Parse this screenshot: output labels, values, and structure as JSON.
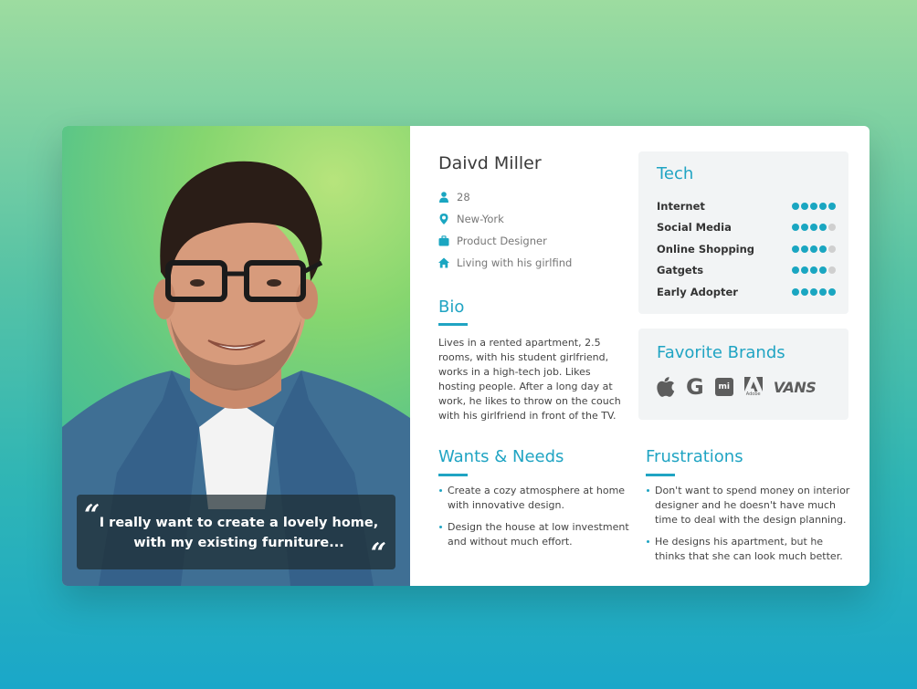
{
  "persona": {
    "name": "Daivd Miller",
    "facts": [
      {
        "icon": "person-icon",
        "text": "28"
      },
      {
        "icon": "location-pin-icon",
        "text": "New-York"
      },
      {
        "icon": "briefcase-icon",
        "text": "Product Designer"
      },
      {
        "icon": "home-icon",
        "text": "Living with his girlfind"
      }
    ]
  },
  "quote": {
    "open_mark": "“",
    "close_mark": "“",
    "text": "I really want to create a lovely home, with my existing furniture..."
  },
  "bio": {
    "title": "Bio",
    "text": "Lives in a rented apartment, 2.5 rooms, with his student girlfriend, works in a high-tech job. Likes hosting people. After a long day at work, he likes to throw on the couch with his girlfriend in front of the TV."
  },
  "wants": {
    "title": "Wants & Needs",
    "items": [
      "Create a cozy atmosphere at home with innovative design.",
      "Design the house at low investment and without much effort."
    ]
  },
  "frustrations": {
    "title": "Frustrations",
    "items": [
      "Don't want to spend money on interior designer and he doesn't have much time to deal with the design planning.",
      "He designs his apartment, but he thinks that she can look much better."
    ]
  },
  "tech": {
    "title": "Tech",
    "items": [
      {
        "label": "Internet",
        "rating": 5,
        "max": 5
      },
      {
        "label": "Social Media",
        "rating": 4,
        "max": 5
      },
      {
        "label": "Online Shopping",
        "rating": 4,
        "max": 5
      },
      {
        "label": "Gatgets",
        "rating": 4,
        "max": 5
      },
      {
        "label": "Early Adopter",
        "rating": 5,
        "max": 5
      }
    ]
  },
  "brands": {
    "title": "Favorite Brands",
    "logos": [
      {
        "icon": "apple-logo-icon"
      },
      {
        "icon": "google-logo-icon",
        "text": "G"
      },
      {
        "icon": "xiaomi-logo-icon",
        "text": "mi"
      },
      {
        "icon": "adobe-logo-icon",
        "text": "Adobe"
      },
      {
        "icon": "vans-logo-icon",
        "text": "VANS"
      }
    ]
  },
  "colors": {
    "accent": "#20a4c3",
    "dot_on": "#1aa6c1",
    "dot_off": "#cfcfcf",
    "panel_bg": "#f2f4f5"
  }
}
